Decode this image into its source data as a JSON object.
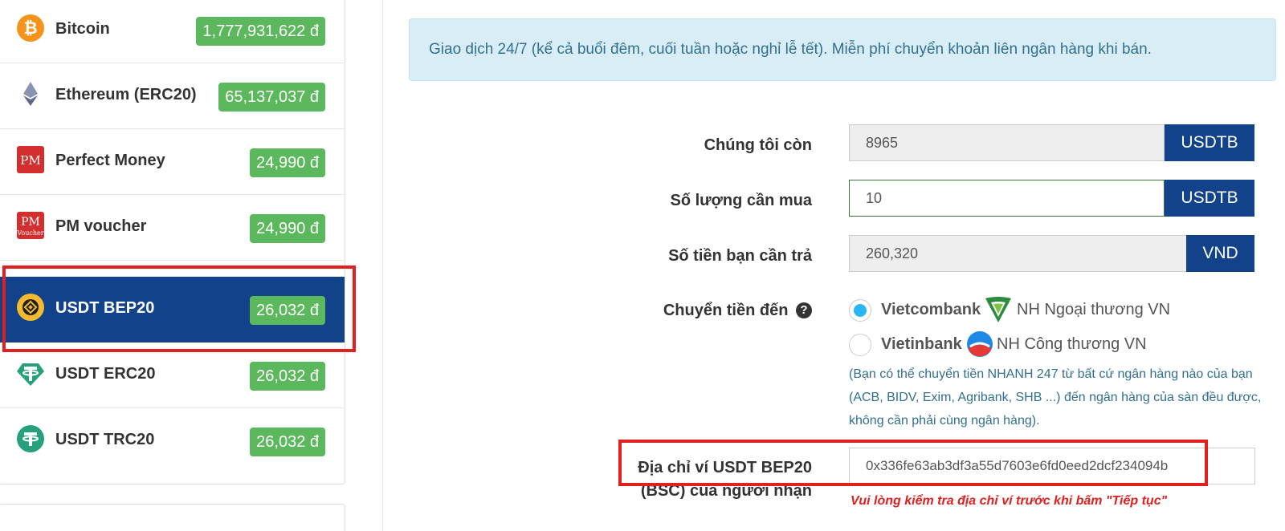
{
  "coins": [
    {
      "name": "Bitcoin",
      "price": "1,777,931,622 đ",
      "icon": "bitcoin-icon"
    },
    {
      "name": "Ethereum (ERC20)",
      "price": "65,137,037 đ",
      "icon": "ethereum-icon"
    },
    {
      "name": "Perfect Money",
      "price": "24,990 đ",
      "icon": "perfect-money-icon"
    },
    {
      "name": "PM voucher",
      "price": "24,990 đ",
      "icon": "pm-voucher-icon"
    },
    {
      "name": "USDT BEP20",
      "price": "26,032 đ",
      "icon": "bnb-icon",
      "active": true
    },
    {
      "name": "USDT ERC20",
      "price": "26,032 đ",
      "icon": "tether-icon"
    },
    {
      "name": "USDT TRC20",
      "price": "26,032 đ",
      "icon": "tether-icon"
    }
  ],
  "notice": "Giao dịch 24/7 (kể cả buổi đêm, cuối tuần hoặc nghỉ lễ tết). Miễn phí chuyển khoản liên ngân hàng khi bán.",
  "form": {
    "stock": {
      "label": "Chúng tôi còn",
      "value": "8965",
      "unit": "USDTB"
    },
    "quantity": {
      "label": "Số lượng cần mua",
      "value": "10",
      "unit": "USDTB"
    },
    "amount": {
      "label": "Số tiền bạn cần trả",
      "value": "260,320",
      "unit": "VND"
    },
    "transfer": {
      "label": "Chuyển tiền đến",
      "help_icon": "?",
      "banks": [
        {
          "name": "Vietcombank",
          "desc": "NH Ngoại thương VN",
          "selected": true
        },
        {
          "name": "Vietinbank",
          "desc": "NH Công thương VN",
          "selected": false
        }
      ],
      "hint": "(Bạn có thể chuyển tiền NHANH 247 từ bất cứ ngân hàng nào của bạn (ACB, BIDV, Exim, Agribank, SHB ...) đến ngân hàng của sàn đều được, không cần phải cùng ngân hàng)."
    },
    "wallet": {
      "label_line1": "Địa chỉ ví USDT BEP20",
      "label_line2": "(BSC) của người nhận",
      "value": "0x336fe63ab3df3a55d7603e6fd0eed2dcf234094b",
      "warning": "Vui lòng kiểm tra địa chỉ ví trước khi bấm \"Tiếp tục\""
    }
  },
  "colors": {
    "active_bg": "#11428a",
    "badge_green": "#5cb85c",
    "highlight_red": "#e2201f",
    "notice_bg": "#d9edf7"
  }
}
